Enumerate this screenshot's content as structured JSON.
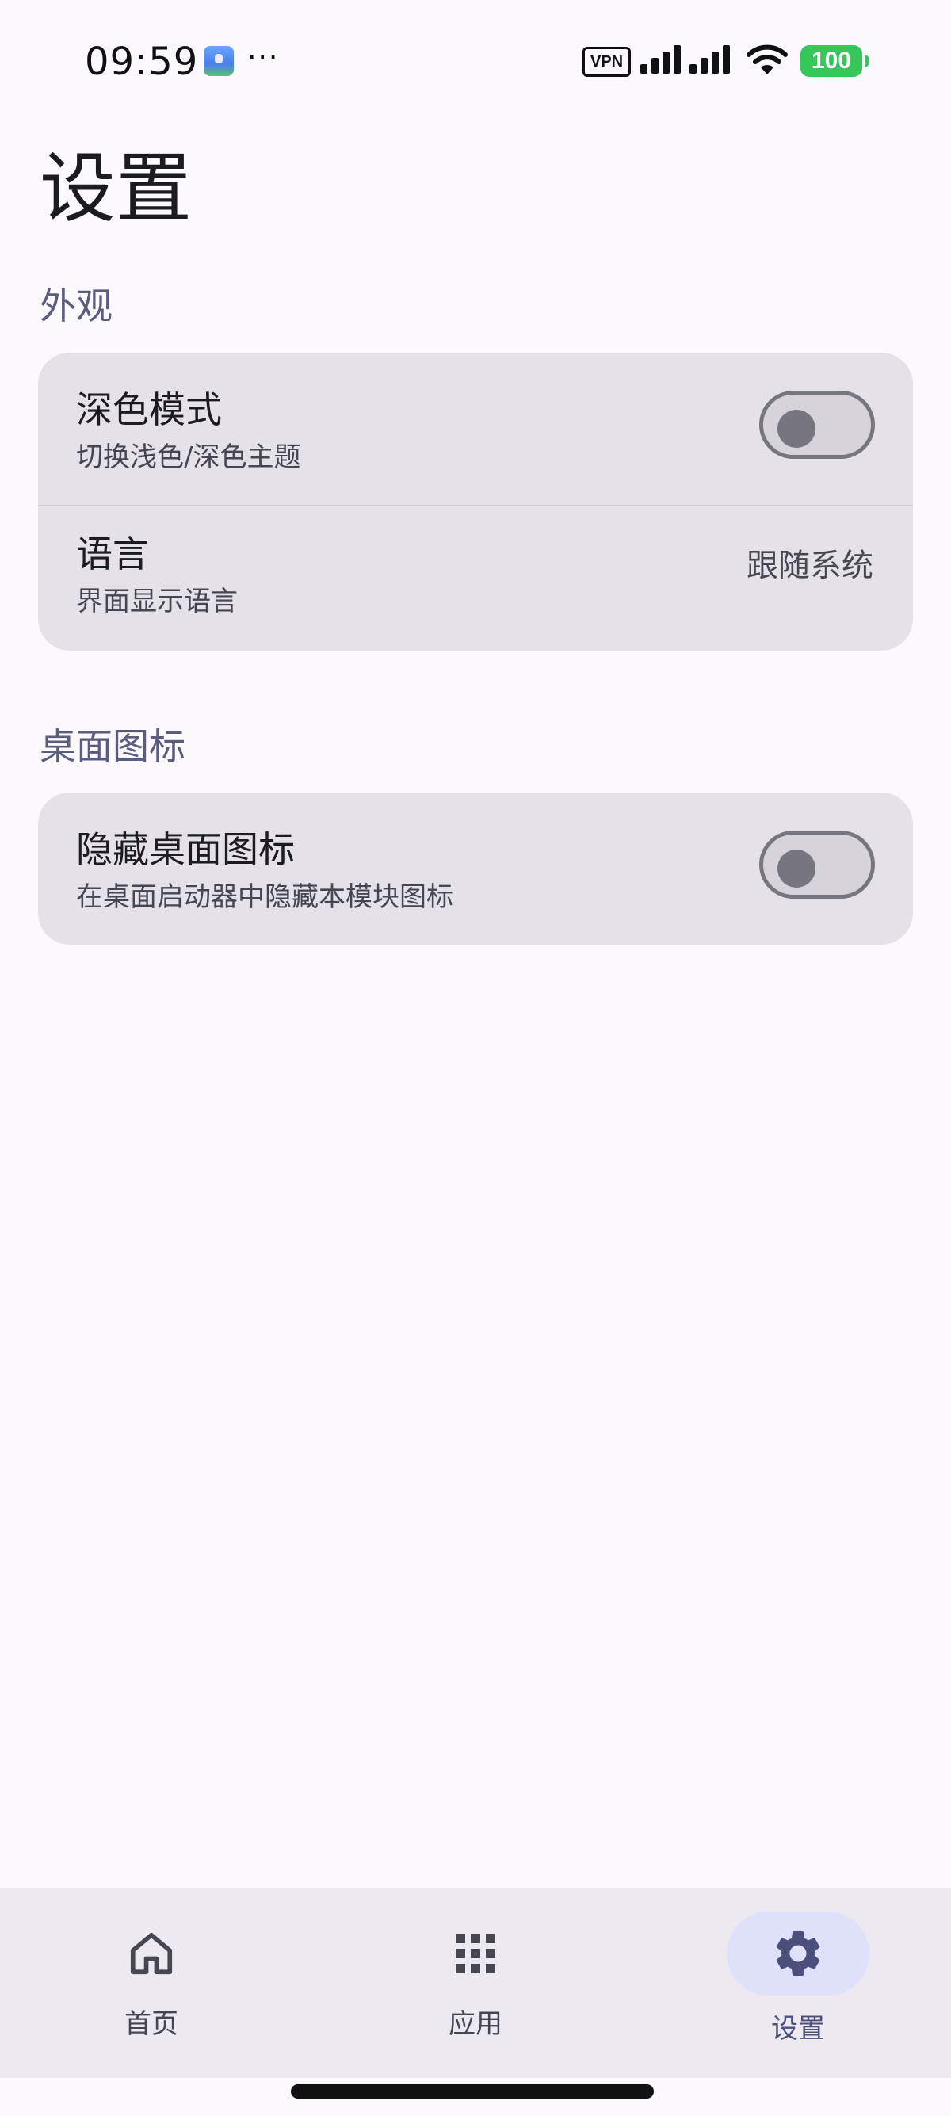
{
  "status_bar": {
    "time": "09:59",
    "more_indicator": "···",
    "vpn_label": "VPN",
    "battery_level": "100",
    "icons": [
      "app-notification-icon",
      "signal-icon",
      "wifi-icon",
      "battery-icon"
    ],
    "battery_color": "#36c759"
  },
  "page": {
    "title": "设置"
  },
  "sections": {
    "appearance": {
      "label": "外观",
      "dark_mode": {
        "title": "深色模式",
        "subtitle": "切换浅色/深色主题",
        "enabled": false
      },
      "language": {
        "title": "语言",
        "subtitle": "界面显示语言",
        "value": "跟随系统"
      }
    },
    "desktop_icon": {
      "label": "桌面图标",
      "hide_icon": {
        "title": "隐藏桌面图标",
        "subtitle": "在桌面启动器中隐藏本模块图标",
        "enabled": false
      }
    }
  },
  "bottom_nav": {
    "items": [
      {
        "label": "首页",
        "icon": "home-icon",
        "active": false
      },
      {
        "label": "应用",
        "icon": "apps-grid-icon",
        "active": false
      },
      {
        "label": "设置",
        "icon": "gear-icon",
        "active": true
      }
    ]
  },
  "colors": {
    "background": "#fbf8fe",
    "card": "#e5e1e8",
    "section_label": "#5b5d7e",
    "nav_active_pill": "#dfe0fa",
    "nav_active_icon": "#4b4f79"
  }
}
